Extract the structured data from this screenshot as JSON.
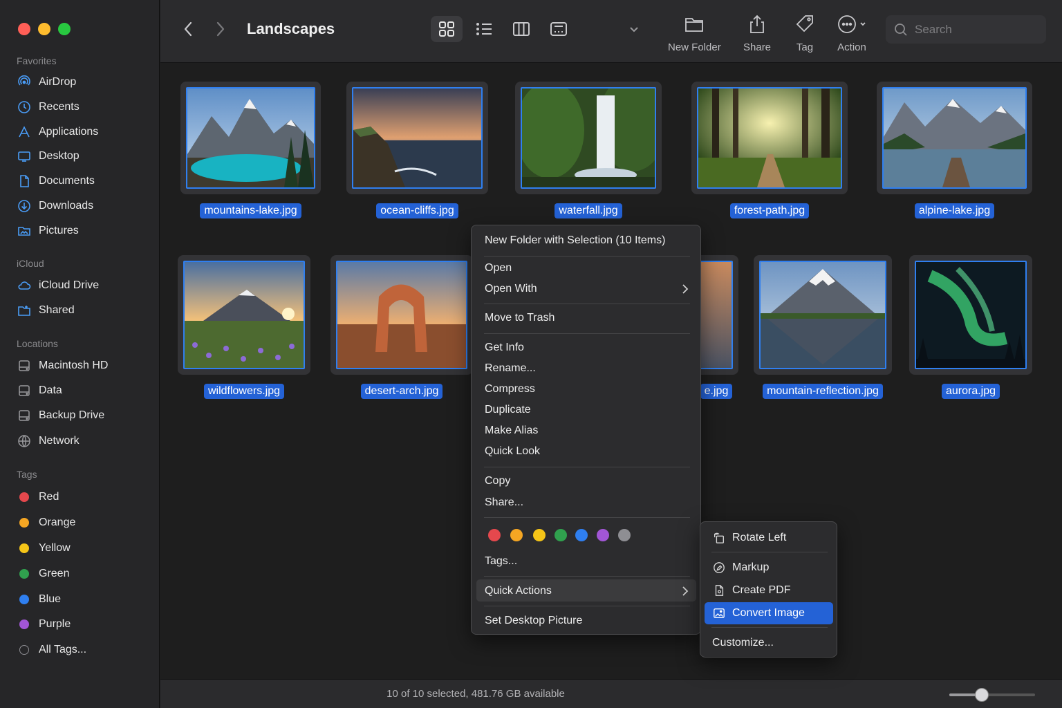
{
  "window": {
    "title": "Landscapes"
  },
  "sidebar": {
    "sections": {
      "favorites": "Favorites",
      "icloud": "iCloud",
      "locations": "Locations",
      "tags": "Tags"
    },
    "favorites": [
      {
        "label": "AirDrop",
        "icon": "airdrop-icon"
      },
      {
        "label": "Recents",
        "icon": "clock-icon"
      },
      {
        "label": "Applications",
        "icon": "applications-icon"
      },
      {
        "label": "Desktop",
        "icon": "desktop-icon"
      },
      {
        "label": "Documents",
        "icon": "document-icon"
      },
      {
        "label": "Downloads",
        "icon": "download-icon"
      },
      {
        "label": "Pictures",
        "icon": "pictures-folder-icon"
      }
    ],
    "icloud": [
      {
        "label": "iCloud Drive",
        "icon": "cloud-icon"
      },
      {
        "label": "Shared",
        "icon": "shared-folder-icon"
      }
    ],
    "locations": [
      {
        "label": "Macintosh HD",
        "icon": "disk-icon"
      },
      {
        "label": "Data",
        "icon": "disk-icon"
      },
      {
        "label": "Backup Drive",
        "icon": "disk-icon"
      },
      {
        "label": "Network",
        "icon": "network-icon"
      }
    ],
    "tags": [
      {
        "label": "Red",
        "color": "#e5484d"
      },
      {
        "label": "Orange",
        "color": "#f5a623"
      },
      {
        "label": "Yellow",
        "color": "#f5c518"
      },
      {
        "label": "Green",
        "color": "#30a14e"
      },
      {
        "label": "Blue",
        "color": "#2f7ff0"
      },
      {
        "label": "Purple",
        "color": "#a256d6"
      },
      {
        "label": "All Tags...",
        "color": ""
      }
    ]
  },
  "toolbar": {
    "new_folder": "New Folder",
    "share": "Share",
    "tag": "Tag",
    "action": "Action",
    "search_placeholder": "Search"
  },
  "files": [
    {
      "name": "mountains-lake.jpg"
    },
    {
      "name": "ocean-cliffs.jpg"
    },
    {
      "name": "waterfall.jpg"
    },
    {
      "name": "forest-path.jpg"
    },
    {
      "name": "alpine-lake.jpg"
    },
    {
      "name": "wildflowers.jpg"
    },
    {
      "name": "desert-arch.jpg"
    },
    {
      "name": "e.jpg"
    },
    {
      "name": "mountain-reflection.jpg"
    },
    {
      "name": "aurora.jpg"
    }
  ],
  "context_menu": {
    "new_folder_selection": "New Folder with Selection (10 Items)",
    "open": "Open",
    "open_with": "Open With",
    "move_to_trash": "Move to Trash",
    "get_info": "Get Info",
    "rename": "Rename...",
    "compress": "Compress",
    "duplicate": "Duplicate",
    "make_alias": "Make Alias",
    "quick_look": "Quick Look",
    "copy": "Copy",
    "share": "Share...",
    "tag_colors": [
      "#e5484d",
      "#f5a623",
      "#f5c518",
      "#30a14e",
      "#2f7ff0",
      "#a256d6",
      "#8e8e93"
    ],
    "tags": "Tags...",
    "quick_actions": "Quick Actions",
    "set_desktop_picture": "Set Desktop Picture"
  },
  "quick_actions_submenu": {
    "rotate_left": "Rotate Left",
    "markup": "Markup",
    "create_pdf": "Create PDF",
    "convert_image": "Convert Image",
    "customize": "Customize..."
  },
  "status": {
    "text": "10 of 10 selected, 481.76 GB available",
    "zoom_level": 0.38
  }
}
